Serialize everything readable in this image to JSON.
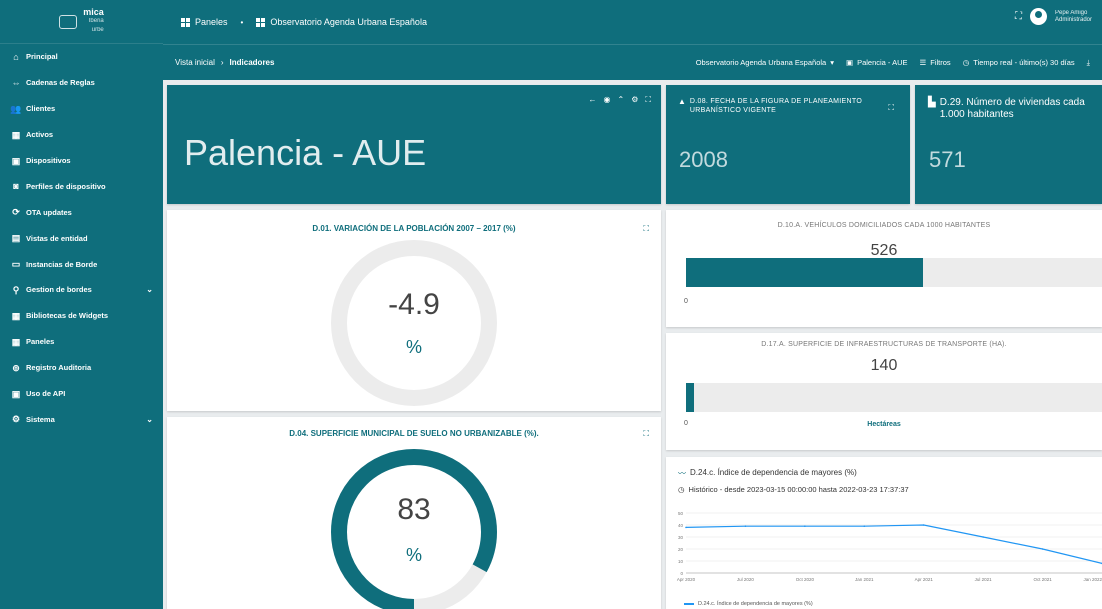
{
  "brand": {
    "name": "mica",
    "sub1": "Iberia",
    "sub2": "urbe"
  },
  "sidebar": {
    "items": [
      {
        "label": "Principal",
        "icon": "home-icon",
        "glyph": "⌂"
      },
      {
        "label": "Cadenas de Reglas",
        "icon": "link-icon",
        "glyph": "⇔"
      },
      {
        "label": "Clientes",
        "icon": "users-icon",
        "glyph": "👥"
      },
      {
        "label": "Activos",
        "icon": "assets-icon",
        "glyph": "▦"
      },
      {
        "label": "Dispositivos",
        "icon": "devices-icon",
        "glyph": "▣"
      },
      {
        "label": "Perfiles de dispositivo",
        "icon": "device-profile-icon",
        "glyph": "◙"
      },
      {
        "label": "OTA updates",
        "icon": "ota-icon",
        "glyph": "⟳"
      },
      {
        "label": "Vistas de entidad",
        "icon": "entity-view-icon",
        "glyph": "▤"
      },
      {
        "label": "Instancias de Borde",
        "icon": "edge-icon",
        "glyph": "▭"
      },
      {
        "label": "Gestion de bordes",
        "icon": "edge-manage-icon",
        "glyph": "⚲",
        "chev": "⌄"
      },
      {
        "label": "Bibliotecas de Widgets",
        "icon": "widgets-icon",
        "glyph": "▦"
      },
      {
        "label": "Paneles",
        "icon": "dashboards-icon",
        "glyph": "▦"
      },
      {
        "label": "Registro Auditoria",
        "icon": "audit-icon",
        "glyph": "⊚"
      },
      {
        "label": "Uso de API",
        "icon": "api-icon",
        "glyph": "▣"
      },
      {
        "label": "Sistema",
        "icon": "settings-icon",
        "glyph": "⚙",
        "chev": "⌄"
      }
    ]
  },
  "topbar": {
    "crumb1": "Paneles",
    "crumb2": "Observatorio Agenda Urbana Española",
    "user_name": "Pepe Amigo",
    "user_role": "Administrador"
  },
  "subbar": {
    "bc1": "Vista inicial",
    "bc2": "Indicadores",
    "tool_dashboard": "Observatorio Agenda Urbana Española",
    "tool_state": "Palencia - AUE",
    "tool_filters": "Filtros",
    "tool_time": "Tiempo real - último(s) 30 días"
  },
  "cards": {
    "main_title": "Palencia - AUE",
    "c1_title": "D.08. FECHA DE LA FIGURA DE PLANEAMIENTO URBANÍSTICO VIGENTE",
    "c1_value": "2008",
    "c2_title": "D.29. Número de viviendas cada 1.000 habitantes",
    "c2_value": "571"
  },
  "donut1": {
    "title": "D.01. VARIACIÓN DE LA POBLACIÓN 2007 – 2017 (%)",
    "value": "-4.9",
    "unit": "%",
    "fraction": 0.0
  },
  "donut2": {
    "title": "D.04. SUPERFICIE MUNICIPAL DE SUELO NO URBANIZABLE (%).",
    "value": "83",
    "unit": "%",
    "fraction": 0.83
  },
  "bar1": {
    "title": "D.10.A. VEHÍCULOS DOMICILIADOS CADA 1000 HABITANTES",
    "value": "526",
    "fraction": 0.57,
    "min": "0"
  },
  "bar2": {
    "title": "D.17.A. SUPERFICIE DE INFRAESTRUCTURAS DE TRANSPORTE (HA).",
    "value": "140",
    "fraction": 0.02,
    "min": "0",
    "unit": "Hectáreas"
  },
  "linechart": {
    "title": "D.24.c. Índice de dependencia de mayores (%)",
    "subtitle": "Histórico - desde 2023-03-15 00:00:00 hasta 2022-03-23 17:37:37",
    "legend": "D.24.c. Índice de dependencia de mayores (%)"
  },
  "chart_data": {
    "type": "line",
    "x": [
      "Apr 2020",
      "Jul 2020",
      "Oct 2020",
      "Jan 2021",
      "Apr 2021",
      "Jul 2021",
      "Oct 2021",
      "Jan 2022"
    ],
    "series": [
      {
        "name": "D.24.c. Índice de dependencia de mayores (%)",
        "values": [
          38,
          39,
          39,
          39,
          40,
          30,
          20,
          8
        ]
      }
    ],
    "ylim": [
      0,
      50
    ],
    "yticks": [
      "0",
      "10",
      "20",
      "30",
      "40",
      "50"
    ],
    "title": "D.24.c. Índice de dependencia de mayores (%)",
    "grid": true,
    "legend": "bottom"
  },
  "colors": {
    "primary": "#0f6e7c",
    "track": "#ececec"
  }
}
